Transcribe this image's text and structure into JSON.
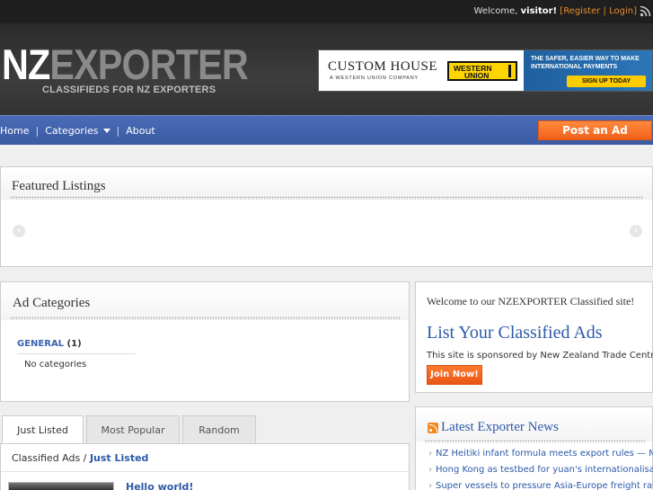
{
  "topbar": {
    "welcome_prefix": "Welcome,",
    "username": "visitor!",
    "register": "Register",
    "separator": "|",
    "login": "Login"
  },
  "header": {
    "logo_nz": "NZ",
    "logo_exporter": "EXPORTER",
    "tagline": "CLASSIFIEDS FOR NZ EXPORTERS"
  },
  "banner": {
    "brand": "CUSTOM HOUSE",
    "brand_sub": "A WESTERN UNION COMPANY",
    "wu_line1": "WESTERN",
    "wu_line2": "UNION",
    "tag_line1": "THE SAFER, EASIER WAY TO MAKE",
    "tag_line2": "INTERNATIONAL PAYMENTS",
    "cta": "SIGN UP TODAY"
  },
  "nav": {
    "home": "Home",
    "categories": "Categories",
    "about": "About",
    "sep": "|",
    "post_ad": "Post an Ad"
  },
  "featured": {
    "title": "Featured Listings"
  },
  "ad_categories": {
    "title": "Ad Categories",
    "category": "GENERAL",
    "count": "(1)",
    "empty": "No categories"
  },
  "welcome_box": {
    "intro": "Welcome to our NZEXPORTER Classified site!",
    "headline": "List Your Classified Ads",
    "sponsor": "This site is sponsored by New Zealand Trade Centre",
    "join": "Join Now!"
  },
  "tabs": [
    {
      "label": "Just Listed"
    },
    {
      "label": "Most Popular"
    },
    {
      "label": "Random"
    }
  ],
  "listing": {
    "crumb_root": "Classified Ads",
    "crumb_sep": "/",
    "crumb_current": "Just Listed",
    "first_title": "Hello world!"
  },
  "news": {
    "title": "Latest Exporter News",
    "items": [
      "NZ Heitiki infant formula meets export rules — MAF",
      "Hong Kong as testbed for yuan's internationalisation",
      "Super vessels to pressure Asia-Europe freight rates"
    ]
  }
}
